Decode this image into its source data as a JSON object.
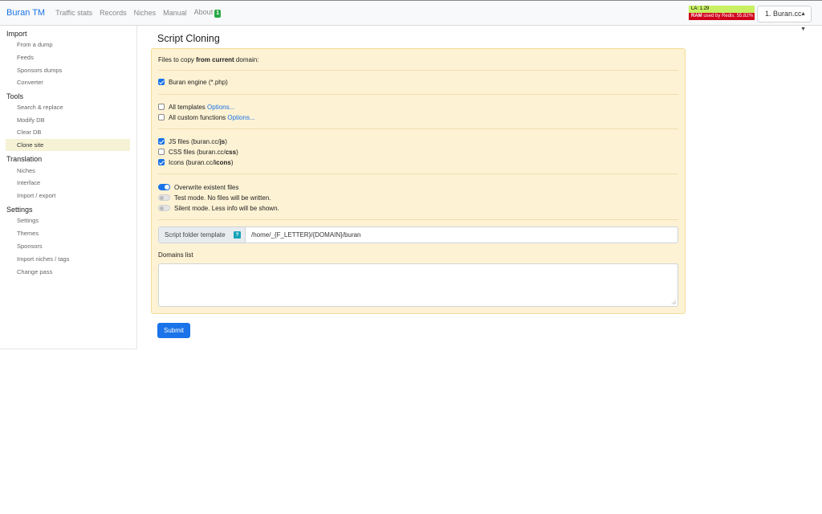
{
  "navbar": {
    "brand": "Buran TM",
    "links": [
      "Traffic stats",
      "Records",
      "Niches",
      "Manual",
      "About"
    ],
    "about_badge": "1",
    "stats": {
      "la_label": "LA:",
      "la_value": "1.29",
      "ram_label": "RAM",
      "ram_text": "used by Redis: 55.82%",
      "la_color": "#c8f062",
      "ram_color": "#d0021b"
    },
    "site_select": "1. Buran.cc"
  },
  "sidebar": {
    "groups": [
      {
        "title": "Import",
        "items": [
          "From a dump",
          "Feeds",
          "Sponsors dumps",
          "Converter"
        ]
      },
      {
        "title": "Tools",
        "items": [
          "Search & replace",
          "Modify DB",
          "Clear DB",
          "Clone site"
        ]
      },
      {
        "title": "Translation",
        "items": [
          "Niches",
          "Interface",
          "Import / export"
        ]
      },
      {
        "title": "Settings",
        "items": [
          "Settings",
          "Themes",
          "Sponsors",
          "Import niches / tags",
          "Change pass"
        ]
      }
    ],
    "active": "Clone site"
  },
  "main": {
    "title": "Script Cloning",
    "intro_prefix": "Files to copy ",
    "intro_bold": "from current",
    "intro_suffix": " domain:",
    "buran_engine": "Buran engine (*.php)",
    "all_templates": "All templates",
    "all_custom_functions": "All custom functions",
    "options_link": "Options...",
    "js_files_prefix": "JS files (buran.cc/",
    "js_files_bold": "js",
    "css_files_prefix": "CSS files (buran.cc/",
    "css_files_bold": "css",
    "icons_prefix": "Icons (buran.cc/",
    "icons_bold": "icons",
    "close_paren": ")",
    "overwrite": "Overwrite existent files",
    "test_mode": "Test mode. No files will be written.",
    "silent_mode": "Silent mode. Less info will be shown.",
    "folder_label": "Script folder template",
    "folder_help": "?",
    "folder_value": "/home/_{F_LETTER}/{DOMAIN}/buran",
    "domains_label": "Domains list",
    "submit": "Submit"
  },
  "colors": {
    "accent": "#1a73e8",
    "card_bg": "#fdf2d4",
    "card_border": "#f3dd96",
    "active_bg": "#f6f2d6"
  }
}
